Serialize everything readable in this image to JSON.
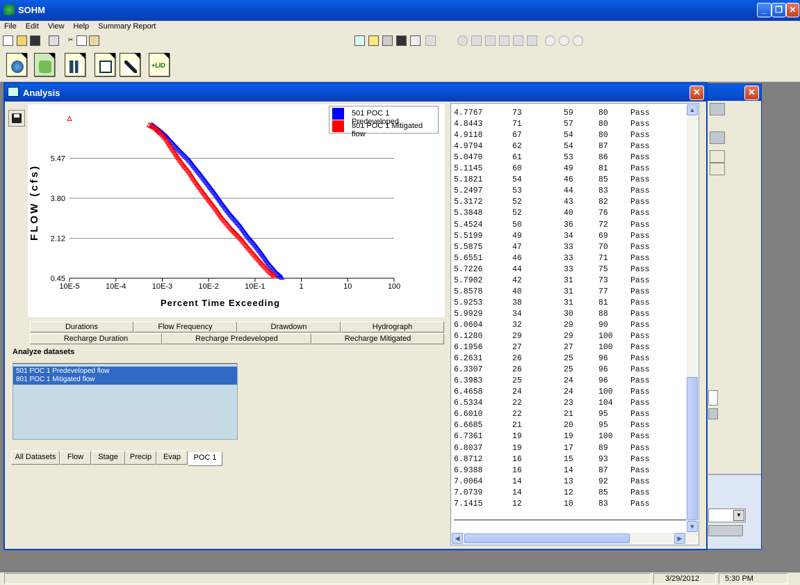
{
  "app": {
    "title": "SOHM"
  },
  "menu": [
    "File",
    "Edit",
    "View",
    "Help",
    "Summary Report"
  ],
  "window": {
    "title": "Analysis"
  },
  "chart_data": {
    "type": "scatter",
    "title": "",
    "xlabel": "Percent Time Exceeding",
    "ylabel": "FLOW (cfs)",
    "x_scale": "log",
    "xlim": [
      1e-05,
      100
    ],
    "ylim": [
      0.45,
      7.15
    ],
    "x_tick_labels": [
      "10E-5",
      "10E-4",
      "10E-3",
      "10E-2",
      "10E-1",
      "1",
      "10",
      "100"
    ],
    "y_ticks": [
      0.45,
      2.12,
      3.8,
      5.47
    ],
    "y_tick_labels": [
      "0.45",
      "2.12",
      "3.80",
      "5.47"
    ],
    "grid": "horizontal",
    "legend": "top-right",
    "series": [
      {
        "name": "501 POC 1 Predeveloped",
        "color": "#0000ff",
        "points": [
          [
            0.0006,
            6.88
          ],
          [
            0.0008,
            6.7
          ],
          [
            0.001,
            6.55
          ],
          [
            0.0013,
            6.35
          ],
          [
            0.0016,
            6.15
          ],
          [
            0.002,
            5.95
          ],
          [
            0.0025,
            5.75
          ],
          [
            0.003,
            5.6
          ],
          [
            0.004,
            5.35
          ],
          [
            0.005,
            5.1
          ],
          [
            0.007,
            4.75
          ],
          [
            0.01,
            4.35
          ],
          [
            0.015,
            3.9
          ],
          [
            0.02,
            3.55
          ],
          [
            0.03,
            3.1
          ],
          [
            0.05,
            2.6
          ],
          [
            0.07,
            2.2
          ],
          [
            0.1,
            1.85
          ],
          [
            0.15,
            1.4
          ],
          [
            0.2,
            1.05
          ],
          [
            0.3,
            0.65
          ],
          [
            0.4,
            0.45
          ]
        ]
      },
      {
        "name": "801 POC 1 Mitigated flow",
        "color": "#ff0000",
        "points": [
          [
            1e-05,
            7.14
          ],
          [
            0.00052,
            6.88
          ],
          [
            0.0007,
            6.75
          ],
          [
            0.0009,
            6.55
          ],
          [
            0.0012,
            6.3
          ],
          [
            0.0015,
            6.0
          ],
          [
            0.0019,
            5.7
          ],
          [
            0.0024,
            5.4
          ],
          [
            0.003,
            5.15
          ],
          [
            0.004,
            4.85
          ],
          [
            0.005,
            4.55
          ],
          [
            0.007,
            4.15
          ],
          [
            0.01,
            3.75
          ],
          [
            0.015,
            3.3
          ],
          [
            0.02,
            2.95
          ],
          [
            0.03,
            2.55
          ],
          [
            0.05,
            2.1
          ],
          [
            0.07,
            1.75
          ],
          [
            0.1,
            1.4
          ],
          [
            0.15,
            1.0
          ],
          [
            0.2,
            0.75
          ],
          [
            0.28,
            0.5
          ]
        ]
      }
    ]
  },
  "tabs_row1": [
    "Durations",
    "Flow Frequency",
    "Drawdown",
    "Hydrograph"
  ],
  "tabs_row2": [
    "Recharge Duration",
    "Recharge Predeveloped",
    "Recharge Mitigated"
  ],
  "analyze": {
    "label": "Analyze datasets",
    "items": [
      "501 POC 1 Predeveloped flow",
      "801 POC 1 Mitigated flow"
    ]
  },
  "dataset_tabs": [
    "All Datasets",
    "Flow",
    "Stage",
    "Precip",
    "Evap",
    "POC 1"
  ],
  "table_rows": [
    [
      "4.7767",
      "73",
      "59",
      "80",
      "Pass"
    ],
    [
      "4.8443",
      "71",
      "57",
      "80",
      "Pass"
    ],
    [
      "4.9118",
      "67",
      "54",
      "80",
      "Pass"
    ],
    [
      "4.9794",
      "62",
      "54",
      "87",
      "Pass"
    ],
    [
      "5.0470",
      "61",
      "53",
      "86",
      "Pass"
    ],
    [
      "5.1145",
      "60",
      "49",
      "81",
      "Pass"
    ],
    [
      "5.1821",
      "54",
      "46",
      "85",
      "Pass"
    ],
    [
      "5.2497",
      "53",
      "44",
      "83",
      "Pass"
    ],
    [
      "5.3172",
      "52",
      "43",
      "82",
      "Pass"
    ],
    [
      "5.3848",
      "52",
      "40",
      "76",
      "Pass"
    ],
    [
      "5.4524",
      "50",
      "36",
      "72",
      "Pass"
    ],
    [
      "5.5199",
      "49",
      "34",
      "69",
      "Pass"
    ],
    [
      "5.5875",
      "47",
      "33",
      "70",
      "Pass"
    ],
    [
      "5.6551",
      "46",
      "33",
      "71",
      "Pass"
    ],
    [
      "5.7226",
      "44",
      "33",
      "75",
      "Pass"
    ],
    [
      "5.7902",
      "42",
      "31",
      "73",
      "Pass"
    ],
    [
      "5.8578",
      "40",
      "31",
      "77",
      "Pass"
    ],
    [
      "5.9253",
      "38",
      "31",
      "81",
      "Pass"
    ],
    [
      "5.9929",
      "34",
      "30",
      "88",
      "Pass"
    ],
    [
      "6.0604",
      "32",
      "29",
      "90",
      "Pass"
    ],
    [
      "6.1280",
      "29",
      "29",
      "100",
      "Pass"
    ],
    [
      "6.1956",
      "27",
      "27",
      "100",
      "Pass"
    ],
    [
      "6.2631",
      "26",
      "25",
      "96",
      "Pass"
    ],
    [
      "6.3307",
      "26",
      "25",
      "96",
      "Pass"
    ],
    [
      "6.3983",
      "25",
      "24",
      "96",
      "Pass"
    ],
    [
      "6.4658",
      "24",
      "24",
      "100",
      "Pass"
    ],
    [
      "6.5334",
      "22",
      "23",
      "104",
      "Pass"
    ],
    [
      "6.6010",
      "22",
      "21",
      "95",
      "Pass"
    ],
    [
      "6.6685",
      "21",
      "20",
      "95",
      "Pass"
    ],
    [
      "6.7361",
      "19",
      "19",
      "100",
      "Pass"
    ],
    [
      "6.8037",
      "19",
      "17",
      "89",
      "Pass"
    ],
    [
      "6.8712",
      "16",
      "15",
      "93",
      "Pass"
    ],
    [
      "6.9388",
      "16",
      "14",
      "87",
      "Pass"
    ],
    [
      "7.0064",
      "14",
      "13",
      "92",
      "Pass"
    ],
    [
      "7.0739",
      "14",
      "12",
      "85",
      "Pass"
    ],
    [
      "7.1415",
      "12",
      "10",
      "83",
      "Pass"
    ]
  ],
  "status": {
    "date": "3/29/2012",
    "time": "5:30 PM"
  }
}
